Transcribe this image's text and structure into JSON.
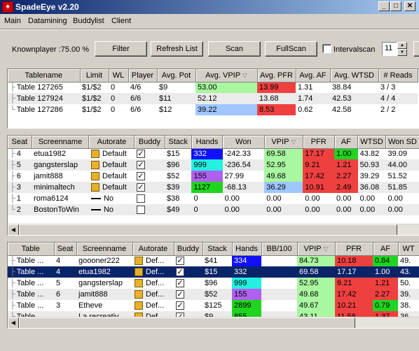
{
  "window": {
    "title": "SpadeEye v2.20",
    "icon": "spade-app-icon"
  },
  "menu": [
    "Main",
    "Datamining",
    "Buddylist",
    "Client"
  ],
  "toolbar": {
    "knownplayer_label": "Knownplayer :75.00 %",
    "filter_label": "Filter",
    "refresh_label": "Refresh List",
    "scan_label": "Scan",
    "fullscan_label": "FullScan",
    "intervalscan_label": "Intervalscan",
    "interval_value": "11"
  },
  "colors": {
    "green": "#a9f7a0",
    "red": "#ef4040",
    "blue": "#9fc6ff",
    "navy": "#1010ff",
    "teal": "#23f0e0",
    "purple": "#b060f0",
    "brightgreen": "#1fd51f",
    "selected": "#0a246a"
  },
  "tables_grid": {
    "headers": [
      "Tablename",
      "Limit",
      "WL",
      "Player",
      "Avg. Pot",
      "Avg. VPIP",
      "Avg. PFR",
      "Avg. AF",
      "Avg. WTSD",
      "# Reads"
    ],
    "rows": [
      [
        "Table  127265",
        "$1/$2",
        "0",
        "4/6",
        "$9",
        "53.00",
        "13.99",
        "1.31",
        "38.84",
        "3 / 3"
      ],
      [
        "Table  127924",
        "$1/$2",
        "0",
        "6/6",
        "$11",
        "52.12",
        "13.68",
        "1.74",
        "42.53",
        "4 / 4"
      ],
      [
        "Table  127286",
        "$1/$2",
        "0",
        "6/6",
        "$12",
        "39.22",
        "8.53",
        "0.62",
        "42.58",
        "2 / 2"
      ]
    ]
  },
  "players_grid": {
    "headers": [
      "Seat",
      "Screenname",
      "Autorate",
      "Buddy",
      "Stack",
      "Hands",
      "Won",
      "VPIP",
      "PFR",
      "AF",
      "WTSD",
      "Won SD"
    ],
    "rows": [
      [
        "4",
        "etua1982",
        "Default",
        "$15",
        "332",
        "-242.33",
        "69.58",
        "17.17",
        "1.00",
        "43.82",
        "39.09"
      ],
      [
        "5",
        "gangsterslap",
        "Default",
        "$96",
        "999",
        "-236.54",
        "52.95",
        "9.21",
        "1.21",
        "50.93",
        "44.00"
      ],
      [
        "6",
        "jamit888",
        "Default",
        "$52",
        "155",
        "27.99",
        "49.68",
        "17.42",
        "2.27",
        "39.29",
        "51.52"
      ],
      [
        "3",
        "minimaltech",
        "Default",
        "$39",
        "1127",
        "-68.13",
        "36.29",
        "10.91",
        "2.49",
        "36.08",
        "51.85"
      ],
      [
        "1",
        "roma6124",
        "No",
        "$38",
        "0",
        "0.00",
        "0.00",
        "0.00",
        "0.00",
        "0.00",
        "0.00"
      ],
      [
        "2",
        "BostonToWin",
        "No",
        "$49",
        "0",
        "0.00",
        "0.00",
        "0.00",
        "0.00",
        "0.00",
        "0.00"
      ]
    ]
  },
  "all_grid": {
    "headers": [
      "Table",
      "Seat",
      "Screenname",
      "Autorate",
      "Buddy",
      "Stack",
      "Hands",
      "BB/100",
      "VPIP",
      "PFR",
      "AF",
      "WT"
    ],
    "rows": [
      [
        "Table ...",
        "4",
        "goooner222",
        "Def...",
        "$41",
        "334",
        "",
        "84.73",
        "10.18",
        "0.84",
        "49."
      ],
      [
        "Table ...",
        "4",
        "etua1982",
        "Def...",
        "$15",
        "332",
        "",
        "69.58",
        "17.17",
        "1.00",
        "43."
      ],
      [
        "Table ...",
        "5",
        "gangsterslap",
        "Def...",
        "$96",
        "999",
        "",
        "52.95",
        "9.21",
        "1.21",
        "50."
      ],
      [
        "Table ...",
        "6",
        "jamit888",
        "Def...",
        "$52",
        "155",
        "",
        "49.68",
        "17.42",
        "2.27",
        "39."
      ],
      [
        "Table ...",
        "3",
        "Etheve",
        "Def...",
        "$125",
        "2899",
        "",
        "49.67",
        "10.21",
        "0.79",
        "38."
      ],
      [
        "Table ...",
        "",
        "La.recreativ",
        "Def...",
        "$9",
        "855",
        "",
        "43.11",
        "11.58",
        "1.37",
        "36."
      ]
    ]
  }
}
